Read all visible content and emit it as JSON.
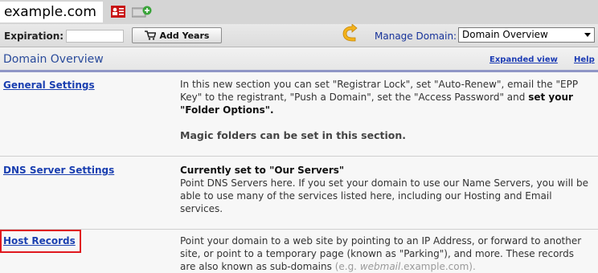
{
  "top": {
    "domain": "example.com",
    "icons": [
      "id-card-icon",
      "add-folder-icon"
    ]
  },
  "toolbar": {
    "expiration_label": "Expiration:",
    "expiration_value": "",
    "add_years_label": "Add Years",
    "manage_label": "Manage Domain:",
    "manage_selected": "Domain Overview"
  },
  "header": {
    "title": "Domain Overview",
    "expanded_view": "Expanded view",
    "help": "Help"
  },
  "rows": [
    {
      "link": "General Settings",
      "desc_pre": "In this new section you can set \"Registrar Lock\", set \"Auto-Renew\", email the \"EPP Key\" to the registrant, \"Push a Domain\", set the \"Access Password\" and ",
      "desc_bold": "set your \"Folder Options\".",
      "note": "Magic folders can be set in this section."
    },
    {
      "link": "DNS Server Settings",
      "status": "Currently set to \"Our Servers\"",
      "desc": "Point DNS Servers here. If you set your domain to use our Name Servers, you will be able to use many of the services listed here, including our Hosting and Email services."
    },
    {
      "link": "Host Records",
      "desc": "Point your domain to a web site by pointing to an IP Address, or forward to another site, or point to a temporary page (known as \"Parking\"), and more. These records are also known as sub-domains",
      "example_pre": " (e.g. ",
      "example_italic": "webmail",
      "example_post": ".example.com)."
    }
  ],
  "colors": {
    "link": "#1a3fb0",
    "highlight": "#e0191f",
    "header_rule": "#8f96c6"
  }
}
